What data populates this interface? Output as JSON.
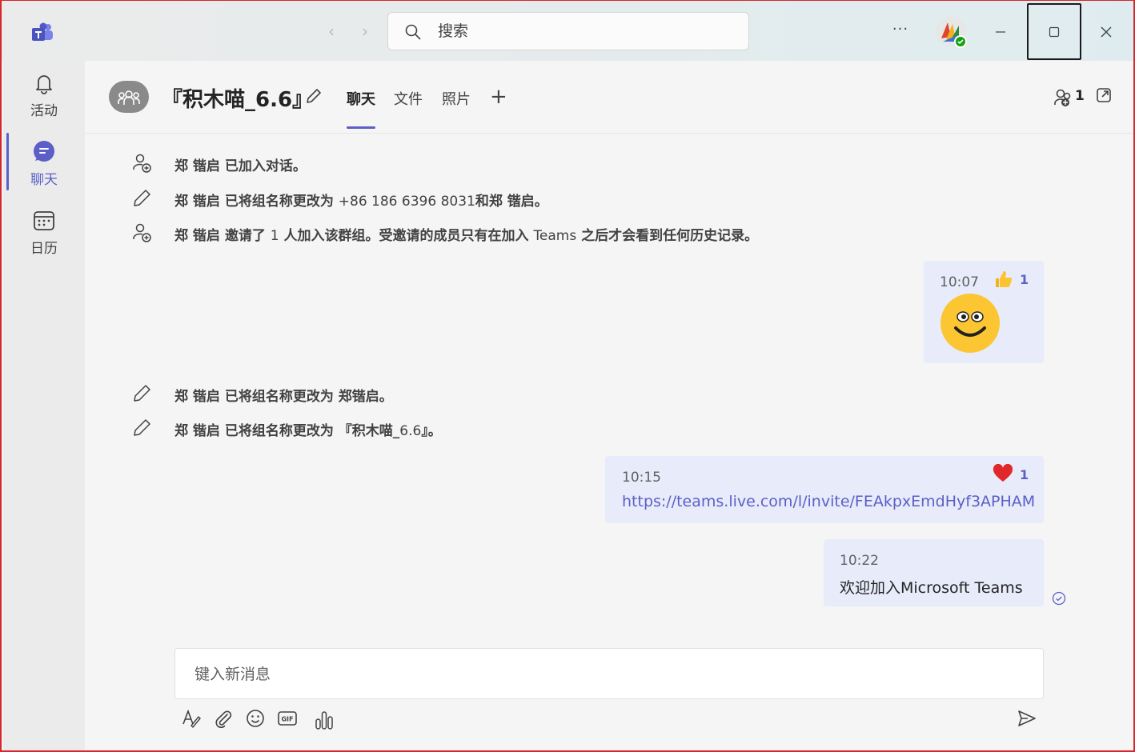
{
  "titlebar": {
    "search_placeholder": "搜索",
    "more_label": "···"
  },
  "rail": {
    "items": [
      {
        "label": "活动",
        "icon": "bell-icon"
      },
      {
        "label": "聊天",
        "icon": "chat-icon",
        "active": true
      },
      {
        "label": "日历",
        "icon": "calendar-icon"
      }
    ]
  },
  "header": {
    "title": "『积木喵_6.6』",
    "tabs": [
      "聊天",
      "文件",
      "照片"
    ],
    "add_tab": "+",
    "participant_count": "1"
  },
  "messages": {
    "system": [
      {
        "name": "郑 锴启",
        "action": "已加入对话。",
        "icon": "person-add-icon"
      },
      {
        "name": "郑 锴启",
        "action": "已将组名称更改为 ",
        "detail": "+86 186 6396 8031",
        "suffix": "和郑 锴启。",
        "icon": "pencil-icon"
      },
      {
        "name": "郑 锴启",
        "action": "邀请了 ",
        "detail": "1",
        "suffix": " 人加入该群组。受邀请的成员只有在加入 ",
        "detail2": "Teams",
        "suffix2": " 之后才会看到任何历史记录。",
        "icon": "person-add-icon"
      },
      {
        "name": "郑 锴启",
        "action": "已将组名称更改为 郑锴启。",
        "icon": "pencil-icon"
      },
      {
        "name": "郑 锴启",
        "action": "已将组名称更改为 『积木喵_",
        "detail": "6.6",
        "suffix": "』。",
        "icon": "pencil-icon"
      }
    ],
    "sent": [
      {
        "time": "10:07",
        "reaction": "thumbs-up-icon",
        "reaction_count": "1",
        "content": "smiley-emoji"
      },
      {
        "time": "10:15",
        "reaction": "heart-icon",
        "reaction_count": "1",
        "content": "https://teams.live.com/l/invite/FEAkpxEmdHyf3APHAM"
      },
      {
        "time": "10:22",
        "content": "欢迎加入Microsoft Teams"
      }
    ]
  },
  "compose": {
    "placeholder": "键入新消息"
  },
  "colors": {
    "accent": "#5b5fc7",
    "bubble": "#e8ebfa",
    "frame": "#d9262c"
  }
}
